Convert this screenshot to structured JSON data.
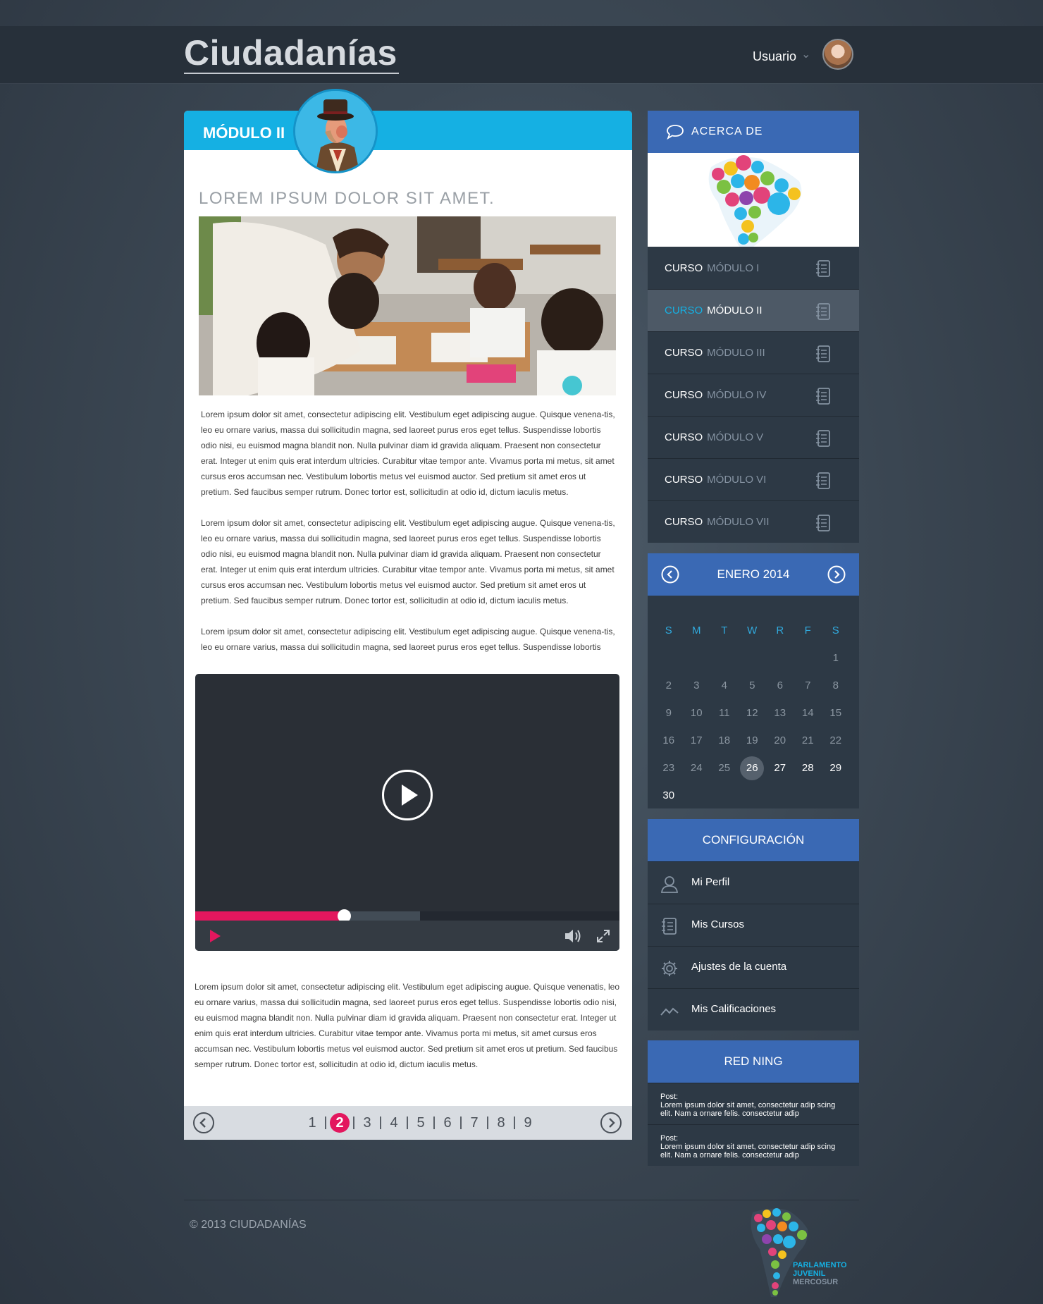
{
  "header": {
    "logo": "Ciudadanías",
    "user_name": "Usuario",
    "user_caret": "⌄"
  },
  "main": {
    "module_title": "MÓDULO II",
    "article_heading": "LOREM IPSUM DOLOR SIT AMET.",
    "paragraphs": [
      "Lorem ipsum dolor sit amet, consectetur adipiscing elit. Vestibulum eget adipiscing augue. Quisque venena-tis, leo eu ornare varius, massa dui sollicitudin magna, sed laoreet purus eros eget tellus. Suspendisse lobortis odio nisi, eu euismod magna blandit non. Nulla pulvinar diam id gravida aliquam. Praesent non consectetur erat. Integer ut enim quis erat interdum ultricies. Curabitur vitae tempor ante. Vivamus porta mi metus, sit amet cursus eros accumsan nec. Vestibulum lobortis metus vel euismod auctor. Sed pretium sit amet eros ut pretium. Sed faucibus semper rutrum. Donec tortor est, sollicitudin at odio id, dictum iaculis metus.",
      "Lorem ipsum dolor sit amet, consectetur adipiscing elit. Vestibulum eget adipiscing augue. Quisque venena-tis, leo eu ornare varius, massa dui sollicitudin magna, sed laoreet purus eros eget tellus. Suspendisse lobortis odio nisi, eu euismod magna blandit non. Nulla pulvinar diam id gravida aliquam. Praesent non consectetur erat. Integer ut enim quis erat interdum ultricies. Curabitur vitae tempor ante. Vivamus porta mi metus, sit amet cursus eros accumsan nec. Vestibulum lobortis metus vel euismod auctor. Sed pretium sit amet eros ut pretium. Sed faucibus semper rutrum. Donec tortor est, sollicitudin at odio id, dictum iaculis metus.",
      "Lorem ipsum dolor sit amet, consectetur adipiscing elit. Vestibulum eget adipiscing augue. Quisque venena-tis, leo eu ornare varius, massa dui sollicitudin magna, sed laoreet purus eros eget tellus. Suspendisse lobortis",
      "Lorem ipsum dolor sit amet, consectetur adipiscing elit. Vestibulum eget adipiscing augue. Quisque venenatis, leo eu ornare varius, massa dui sollicitudin magna, sed laoreet purus eros eget tellus. Suspendisse lobortis odio nisi, eu euismod magna blandit non. Nulla pulvinar diam id gravida aliquam. Praesent non consectetur erat. Integer ut enim quis erat interdum ultricies. Curabitur vitae tempor ante. Vivamus porta mi metus, sit amet cursus eros accumsan nec. Vestibulum lobortis metus vel euismod auctor. Sed pretium sit amet eros ut pretium. Sed faucibus semper rutrum. Donec tortor est, sollicitudin at odio id, dictum iaculis metus."
    ],
    "video": {
      "progress_fraction": 0.35,
      "buffered_fraction": 0.53,
      "accent": "#e3175e"
    },
    "pagination": {
      "pages": [
        "1",
        "2",
        "3",
        "4",
        "5",
        "6",
        "7",
        "8",
        "9"
      ],
      "active_index": 1
    }
  },
  "sidebar": {
    "about_title": "ACERCA DE",
    "courses": [
      {
        "word": "CURSO",
        "module": "MÓDULO I"
      },
      {
        "word": "CURSO",
        "module": "MÓDULO II"
      },
      {
        "word": "CURSO",
        "module": "MÓDULO III"
      },
      {
        "word": "CURSO",
        "module": "MÓDULO IV"
      },
      {
        "word": "CURSO",
        "module": "MÓDULO V"
      },
      {
        "word": "CURSO",
        "module": "MÓDULO VI"
      },
      {
        "word": "CURSO",
        "module": "MÓDULO VII"
      }
    ],
    "active_course": 1,
    "calendar": {
      "month_label": "ENERO 2014",
      "weekdays": [
        "S",
        "M",
        "T",
        "W",
        "R",
        "F",
        "S"
      ],
      "weeks": [
        [
          "",
          "",
          "",
          "",
          "",
          "",
          "1"
        ],
        [
          "2",
          "3",
          "4",
          "5",
          "6",
          "7",
          "8"
        ],
        [
          "9",
          "10",
          "11",
          "12",
          "13",
          "14",
          "15"
        ],
        [
          "16",
          "17",
          "18",
          "19",
          "20",
          "21",
          "22"
        ],
        [
          "23",
          "24",
          "25",
          "26",
          "27",
          "28",
          "29"
        ],
        [
          "30",
          "",
          "",
          "",
          "",
          "",
          ""
        ]
      ],
      "today": "26",
      "upcoming": [
        "27",
        "28",
        "29",
        "30"
      ]
    },
    "config": {
      "title": "CONFIGURACIÓN",
      "items": [
        {
          "label": "Mi Perfil",
          "icon": "user-icon"
        },
        {
          "label": "Mis Cursos",
          "icon": "notebook-icon"
        },
        {
          "label": "Ajustes de la cuenta",
          "icon": "gear-icon"
        },
        {
          "label": "Mis Calificaciones",
          "icon": "chart-line-icon"
        }
      ]
    },
    "ning": {
      "title": "RED NING",
      "posts": [
        {
          "label": "Post:",
          "text": "Lorem ipsum dolor sit amet, consectetur adip scing elit. Nam a ornare felis. consectetur adip"
        },
        {
          "label": "Post:",
          "text": "Lorem ipsum dolor sit amet, consectetur adip scing elit. Nam a ornare felis. consectetur adip"
        }
      ]
    }
  },
  "footer": {
    "copyright": "© 2013 CIUDADANÍAS",
    "logo_lines": [
      "PARLAMENTO",
      "JUVENIL",
      "MERCOSUR"
    ]
  },
  "colors": {
    "accent_blue": "#15b0e3",
    "header_blue": "#3a69b4",
    "accent_pink": "#e3175e",
    "panel": "#2d3945"
  }
}
